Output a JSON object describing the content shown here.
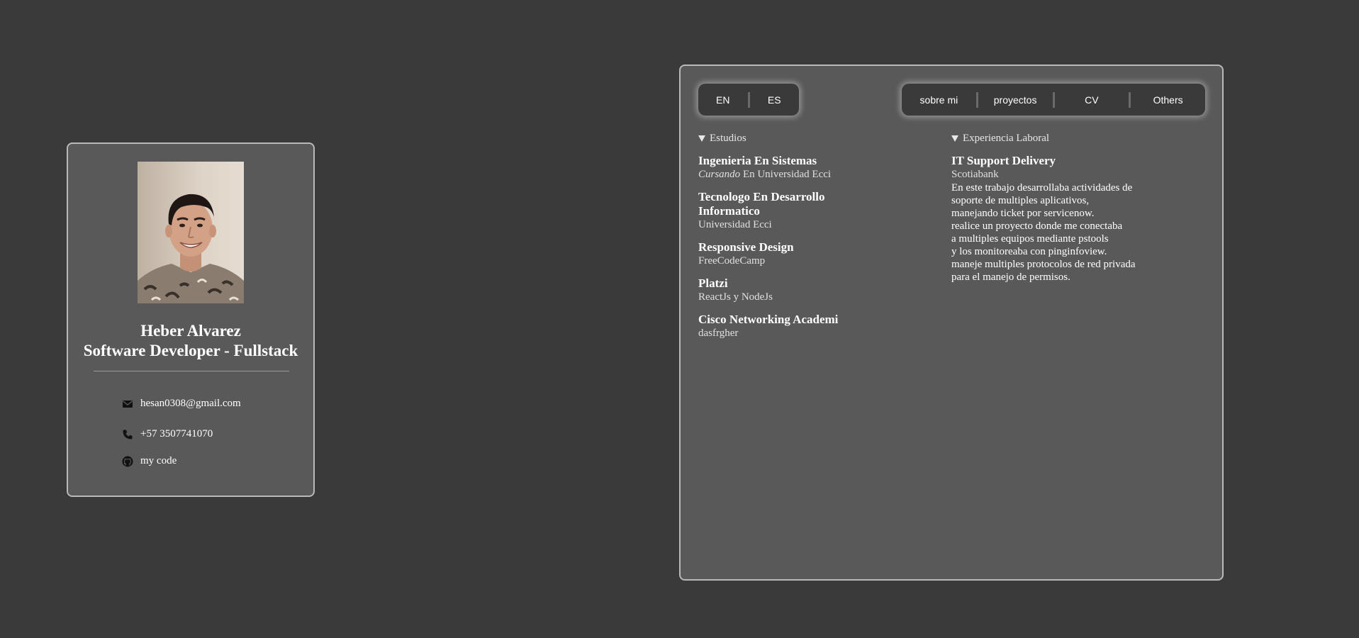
{
  "profile": {
    "name": "Heber Alvarez",
    "role": "Software Developer - Fullstack",
    "contacts": {
      "email": "hesan0308@gmail.com",
      "phone": "+57 3507741070",
      "code": "my code"
    }
  },
  "language": {
    "en": "EN",
    "es": "ES"
  },
  "nav": {
    "about": "sobre mi",
    "projects": "proyectos",
    "cv": "CV",
    "others": "Others"
  },
  "studies": {
    "summary": "Estudios",
    "items": [
      {
        "title": "Ingenieria En Sistemas",
        "status": "Cursando",
        "place": "En Universidad Ecci"
      },
      {
        "title_line1": "Tecnologo En Desarrollo",
        "title_line2": "Informatico",
        "place": "Universidad Ecci"
      },
      {
        "title": "Responsive Design",
        "place": "FreeCodeCamp"
      },
      {
        "title": "Platzi",
        "place": "ReactJs y NodeJs"
      },
      {
        "title": "Cisco Networking Academi",
        "place": "dasfrgher"
      }
    ]
  },
  "experience": {
    "summary": "Experiencia Laboral",
    "items": [
      {
        "title": "IT Support Delivery",
        "company": "Scotiabank",
        "description": [
          "En este trabajo desarrollaba actividades de",
          "soporte de multiples aplicativos,",
          "manejando ticket por servicenow.",
          "realice un proyecto donde me conectaba",
          "a multiples equipos mediante pstools",
          "y los monitoreaba con pinginfoview.",
          "maneje multiples protocolos de red privada",
          "para el manejo de permisos."
        ]
      }
    ]
  },
  "icons": {
    "email": "envelope-icon",
    "phone": "phone-icon",
    "code": "github-icon",
    "disclosure": "triangle-down-icon"
  },
  "colors": {
    "background": "#3a3a3a",
    "card": "#595959",
    "card_border": "#b9b9b9",
    "nav_bg": "#3a3a3a",
    "text": "#ffffff"
  }
}
